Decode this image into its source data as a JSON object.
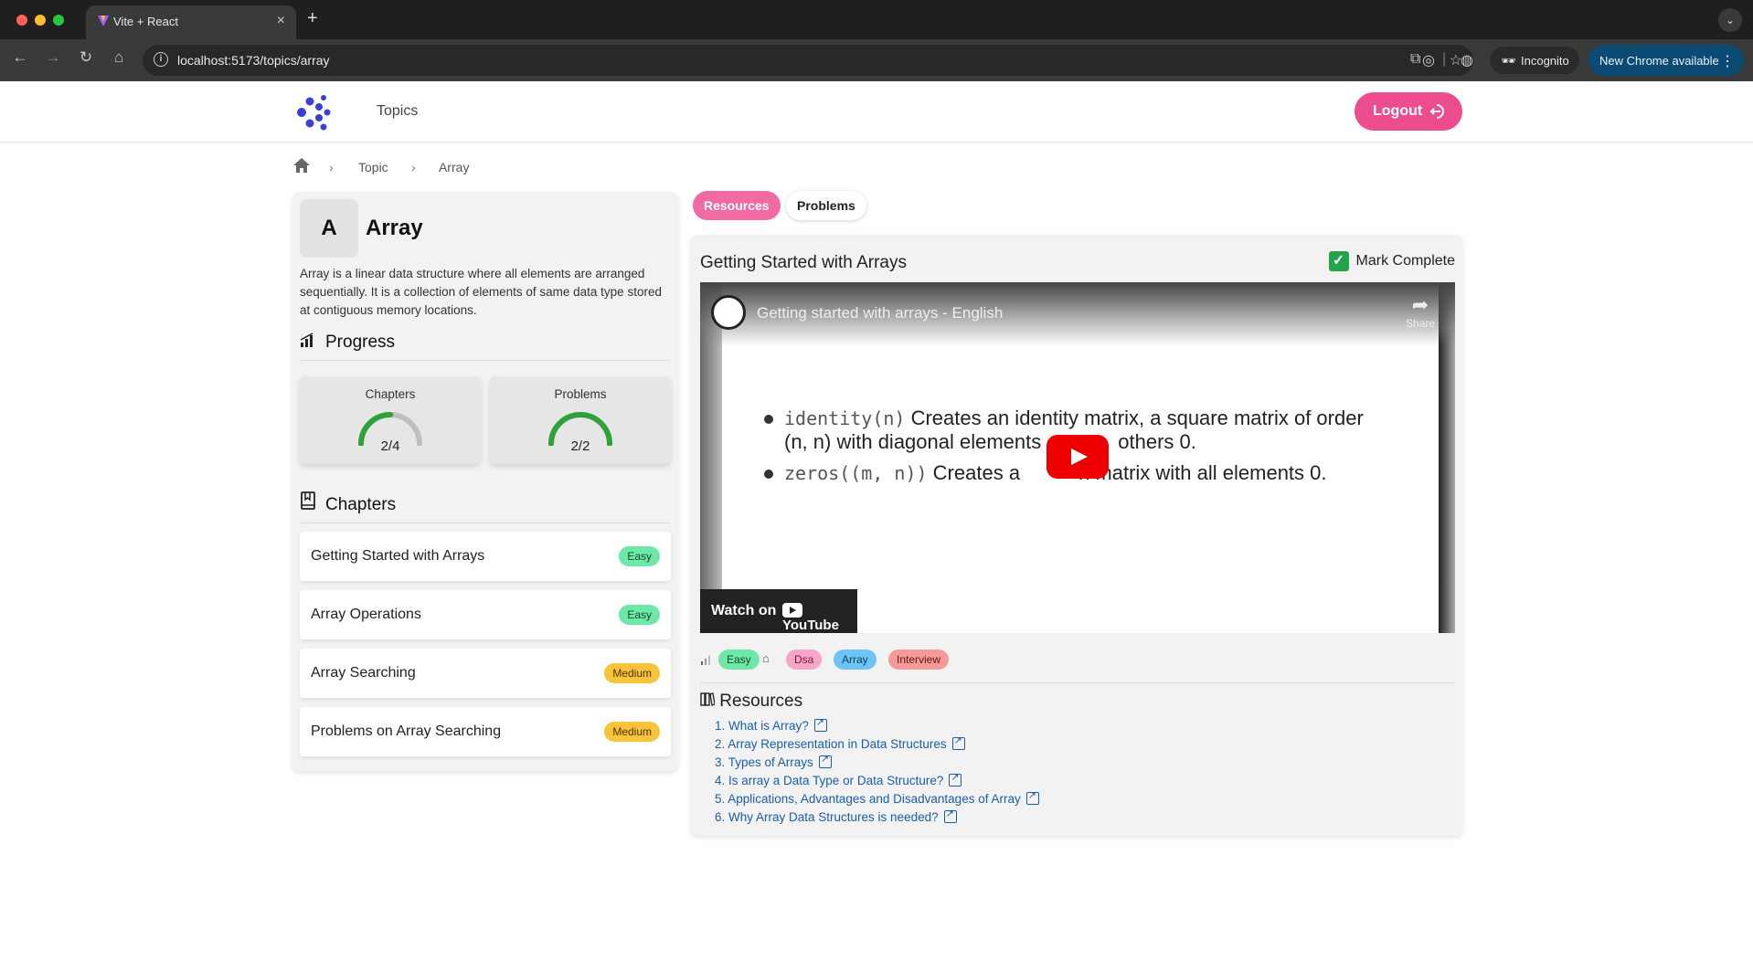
{
  "browser": {
    "tab_title": "Vite + React",
    "url": "localhost:5173/topics/array",
    "incognito_label": "Incognito",
    "update_label": "New Chrome available",
    "traffic_colors": [
      "#ff5f57",
      "#febc2e",
      "#28c840"
    ]
  },
  "header": {
    "nav_topics": "Topics",
    "logout_label": "Logout",
    "accent": "#ec4d8e",
    "logo_color": "#3b3fd6"
  },
  "breadcrumb": {
    "items": [
      "Topic",
      "Array"
    ]
  },
  "topic": {
    "initial": "A",
    "name": "Array",
    "description": "Array is a linear data structure where all elements are arranged sequentially. It is a collection of elements of same data type stored at contiguous memory locations."
  },
  "progress": {
    "title": "Progress",
    "chapters": {
      "label": "Chapters",
      "value": "2/4",
      "done": 2,
      "total": 4
    },
    "problems": {
      "label": "Problems",
      "value": "2/2",
      "done": 2,
      "total": 2
    },
    "color": "#2fa13a"
  },
  "chapters": {
    "title": "Chapters",
    "items": [
      {
        "name": "Getting Started with Arrays",
        "level": "Easy"
      },
      {
        "name": "Array Operations",
        "level": "Easy"
      },
      {
        "name": "Array Searching",
        "level": "Medium"
      },
      {
        "name": "Problems on Array Searching",
        "level": "Medium"
      }
    ]
  },
  "tabs": {
    "resources": "Resources",
    "problems": "Problems"
  },
  "content": {
    "title": "Getting Started with Arrays",
    "mark_complete": "Mark Complete",
    "video": {
      "title": "Getting started with arrays - English",
      "share": "Share",
      "line1_code": "identity(n)",
      "line1_text": "Creates an identity matrix, a square matrix of order",
      "line2_text": "(n, n) with diagonal elements",
      "line2_tail": "others 0.",
      "line3_code": "zeros((m,  n))",
      "line3_text": "Creates a",
      "line3_tail": "n matrix with all elements 0.",
      "watch_on": "Watch on",
      "youtube": "YouTube"
    },
    "tags": [
      "Easy",
      "Dsa",
      "Array",
      "Interview"
    ],
    "resources_title": "Resources",
    "resources": [
      "1. What is Array?",
      "2. Array Representation in Data Structures",
      "3. Types of Arrays",
      "4. Is array a Data Type or Data Structure?",
      "5. Applications, Advantages and Disadvantages of Array",
      "6. Why Array Data Structures is needed?"
    ]
  }
}
